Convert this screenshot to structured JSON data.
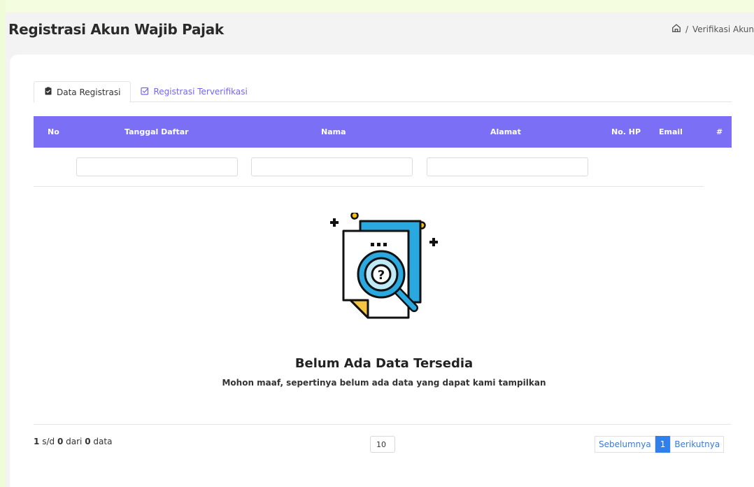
{
  "header": {
    "title": "Registrasi Akun Wajib Pajak",
    "breadcrumb_sep": "/",
    "breadcrumb_current": "Verifikasi Akun"
  },
  "tabs": [
    {
      "label": "Data Registrasi",
      "icon": "clipboard-icon",
      "active": true
    },
    {
      "label": "Registrasi Terverifikasi",
      "icon": "check-square-icon",
      "active": false
    }
  ],
  "table": {
    "columns": [
      "No",
      "Tanggal Daftar",
      "Nama",
      "Alamat",
      "No. HP",
      "Email",
      "#"
    ],
    "header_color": "#7b6ff6",
    "filters": [
      "",
      "",
      ""
    ],
    "rows": []
  },
  "empty_state": {
    "title": "Belum Ada Data Tersedia",
    "subtitle": "Mohon maaf, sepertinya belum ada data yang dapat kami tampilkan",
    "icon": "search-document-icon"
  },
  "footer": {
    "from": "1",
    "sd": "s/d",
    "to": "0",
    "dari": "dari",
    "total": "0",
    "data": "data",
    "page_size": "10",
    "prev_label": "Sebelumnya",
    "current_page": "1",
    "next_label": "Berikutnya"
  }
}
